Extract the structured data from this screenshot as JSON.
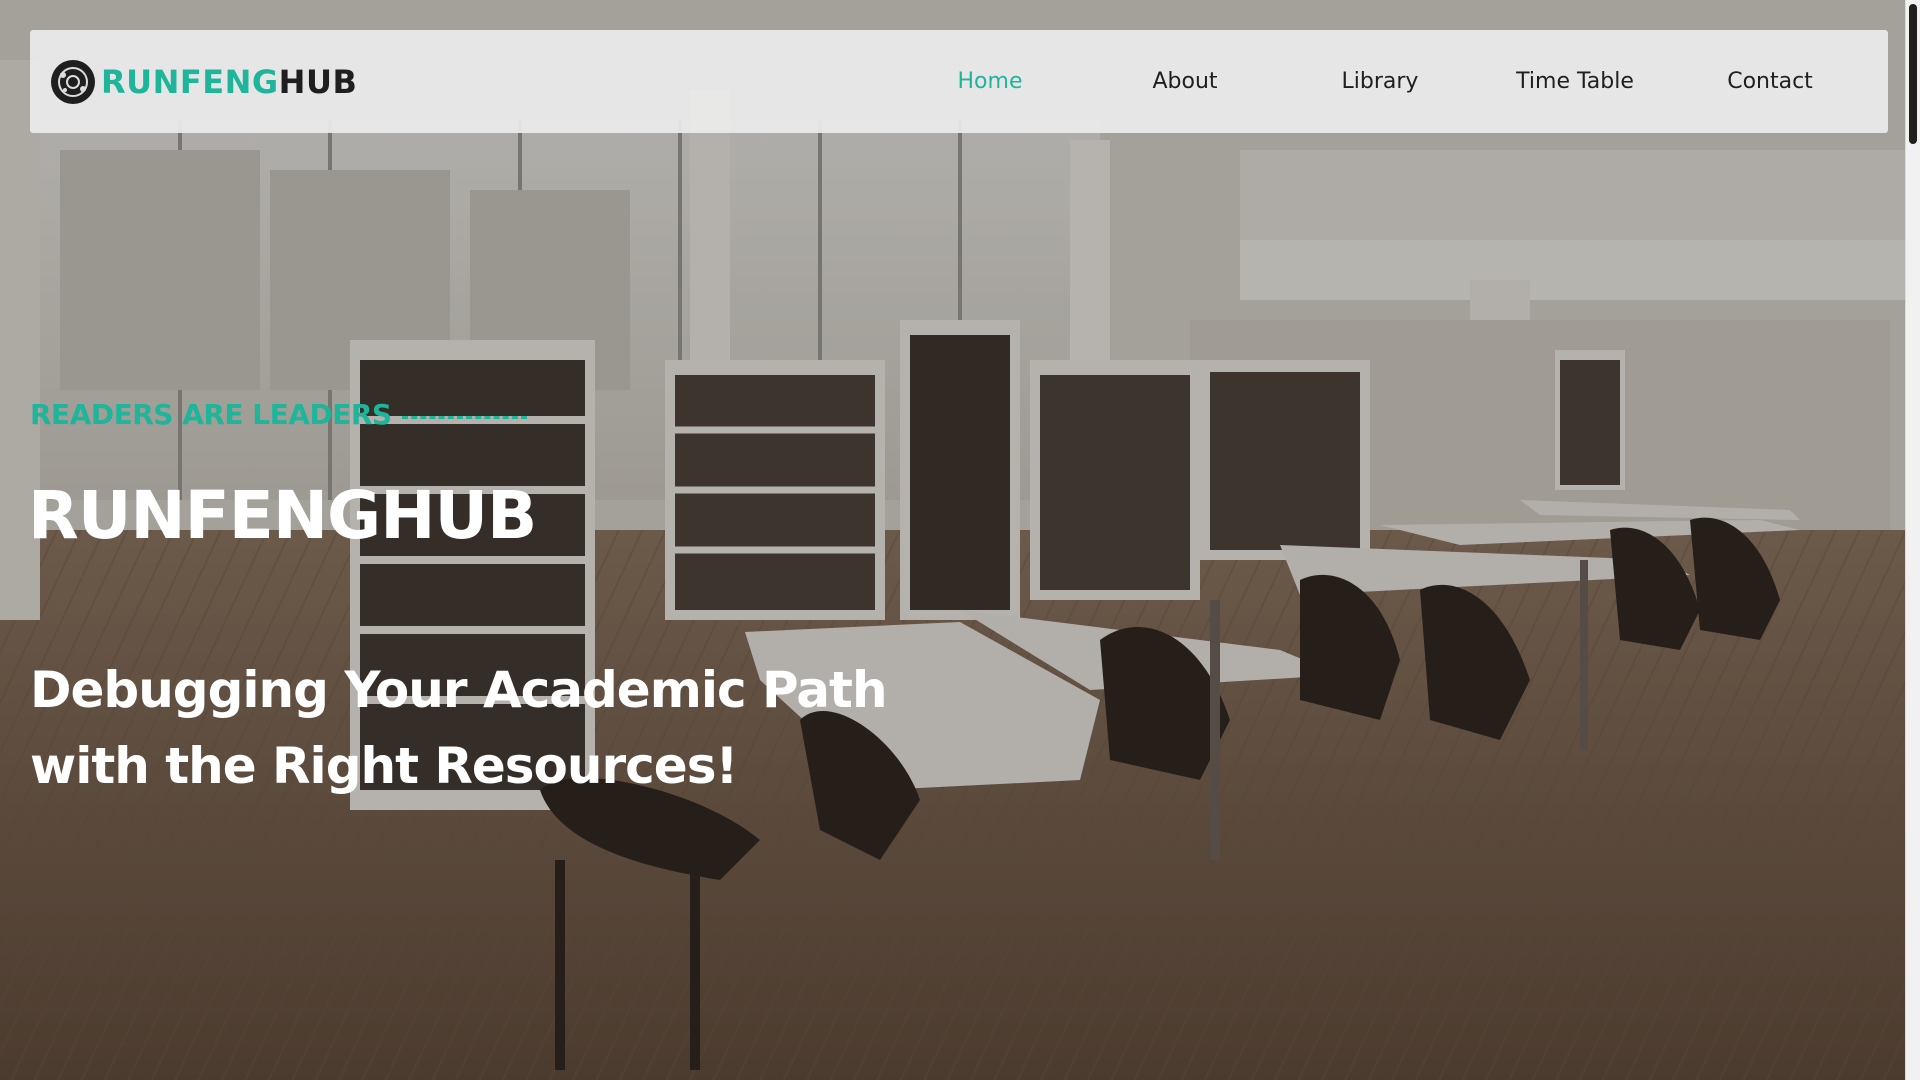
{
  "brand": {
    "name_accent": "RUNFENG",
    "name_dark": "HUB",
    "logo_icon": "circular-emblem-icon"
  },
  "nav": {
    "items": [
      {
        "label": "Home",
        "active": true
      },
      {
        "label": "About",
        "active": false
      },
      {
        "label": "Library",
        "active": false
      },
      {
        "label": "Time Table",
        "active": false
      },
      {
        "label": "Contact",
        "active": false
      }
    ]
  },
  "hero": {
    "tagline": "READERS ARE LEADERS",
    "title": "RUNFENGHUB",
    "subtitle": "Debugging Your Academic Path with the Right Resources!",
    "background_image": "library interior with bookshelves, white tables and dark chairs"
  },
  "colors": {
    "accent": "#1fb59b",
    "dark_text": "#1f1f1f",
    "nav_bg": "#ececec",
    "hero_text": "#ffffff"
  }
}
